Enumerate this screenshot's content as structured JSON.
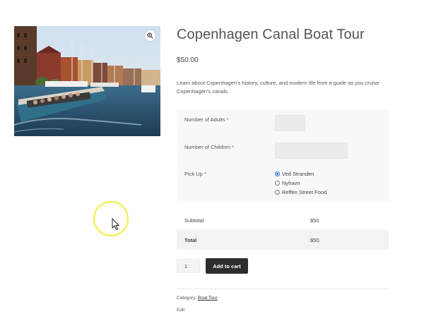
{
  "product": {
    "title": "Copenhagen Canal Boat Tour",
    "price": "$50.00",
    "description": "Learn about Copenhagen's history, culture, and modern life from a guide as you cruise Copenhagen's canals.",
    "image_alt": "canal boat tour photo",
    "zoom_icon": "magnifier-zoom-icon"
  },
  "form": {
    "adults_label": "Number of Adults",
    "children_label": "Number of Children",
    "pickup_label": "Pick Up",
    "required_mark": "*",
    "adults_value": "",
    "children_value": "",
    "pickup_options": [
      {
        "label": "Ved Stranden",
        "checked": true
      },
      {
        "label": "Nyhavn",
        "checked": false
      },
      {
        "label": "Reffen Street Food",
        "checked": false
      }
    ]
  },
  "totals": {
    "subtotal_label": "Subtotal",
    "subtotal_value": "$50",
    "total_label": "Total",
    "total_value": "$50"
  },
  "cart": {
    "quantity": "1",
    "add_label": "Add to cart"
  },
  "meta": {
    "category_label": "Category:",
    "category_link": "Boat Tour",
    "edit_label": "Edit"
  },
  "colors": {
    "accent": "#2b6cd4",
    "button_bg": "#2d2d2d",
    "cursor_highlight": "#f2ee3a"
  }
}
